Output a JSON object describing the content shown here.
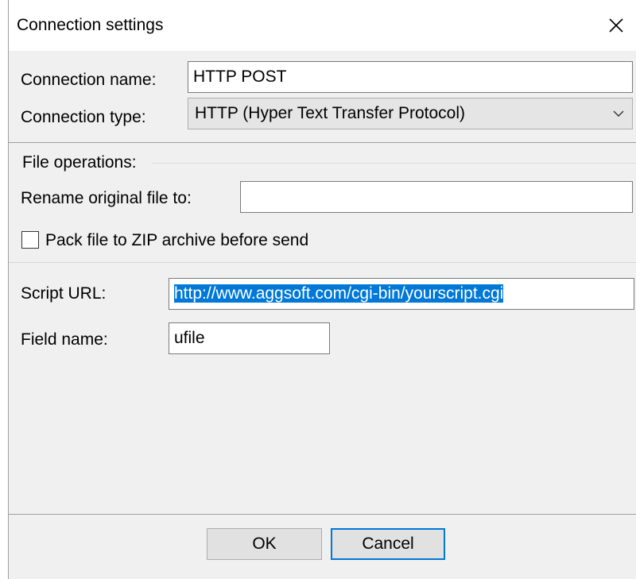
{
  "window": {
    "title": "Connection settings"
  },
  "connection": {
    "name_label": "Connection name:",
    "name_value": "HTTP POST",
    "type_label": "Connection type:",
    "type_value": "HTTP (Hyper Text Transfer Protocol)"
  },
  "file_operations": {
    "group_label": "File operations:",
    "rename_label": "Rename original file to:",
    "rename_value": "",
    "pack_label": "Pack file to ZIP archive before send",
    "pack_checked": false
  },
  "http": {
    "script_url_label": "Script URL:",
    "script_url_value": "http://www.aggsoft.com/cgi-bin/yourscript.cgi",
    "field_name_label": "Field name:",
    "field_name_value": "ufile"
  },
  "buttons": {
    "ok_label": "OK",
    "cancel_label": "Cancel"
  },
  "icons": {
    "close": "close-icon",
    "dropdown": "chevron-down-icon"
  },
  "colors": {
    "selection": "#0078d7",
    "focus_border": "#0078d7",
    "client_bg": "#f0f0f0"
  }
}
